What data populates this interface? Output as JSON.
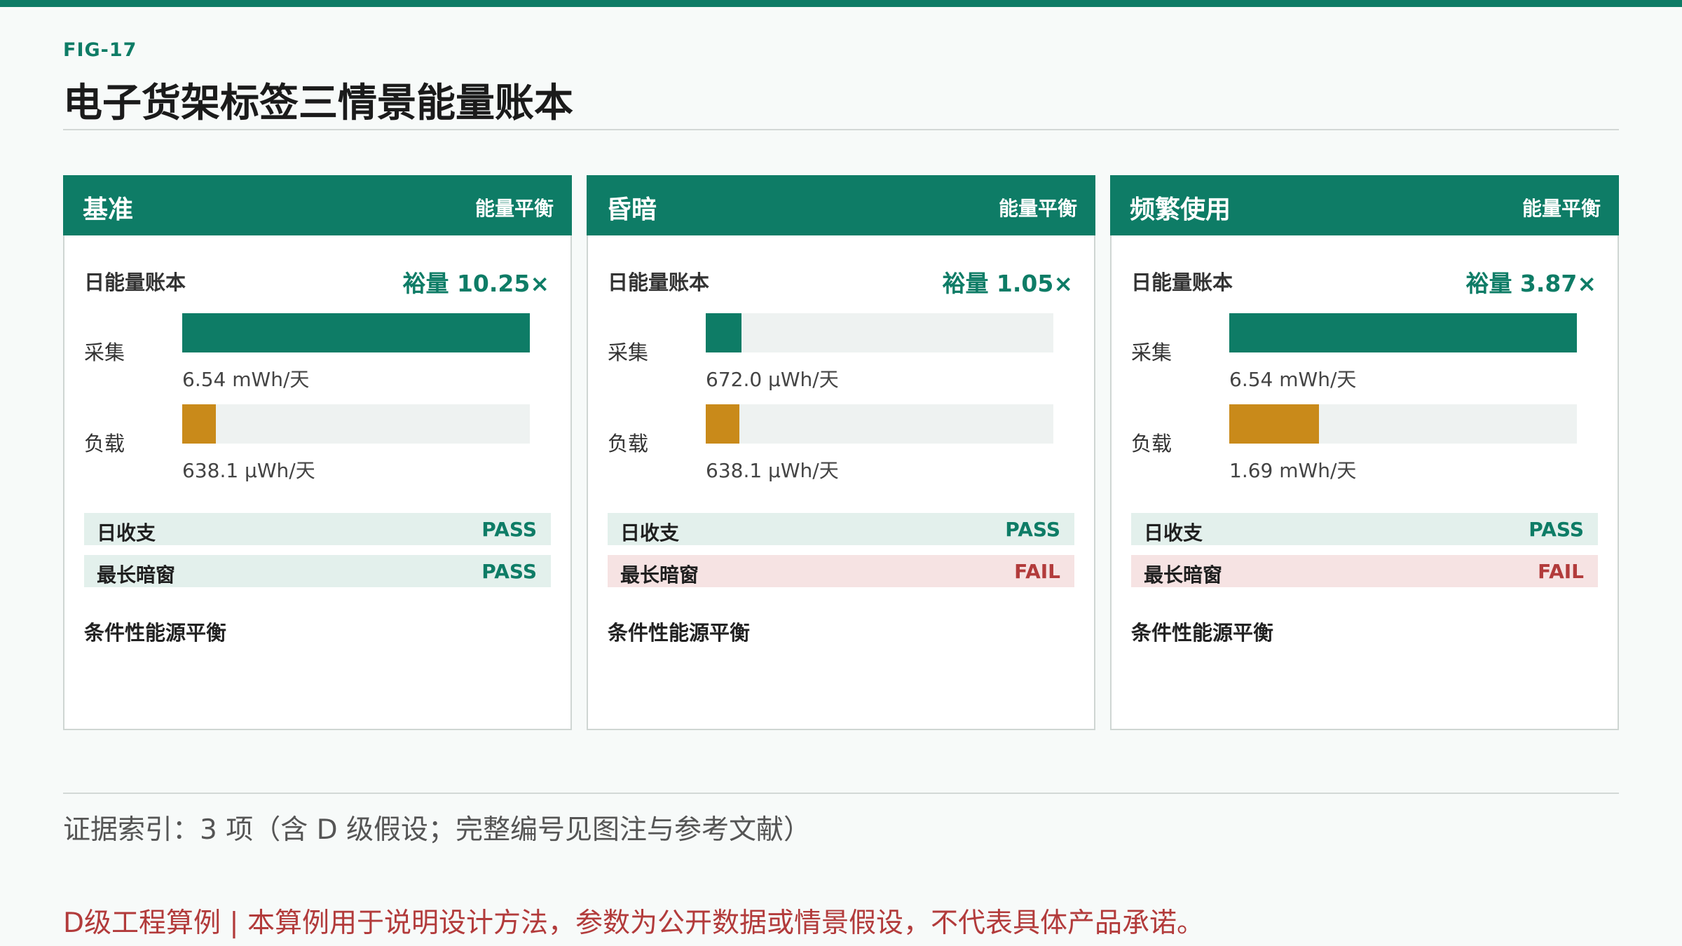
{
  "fig_id": "FIG-17",
  "title": "电子货架标签三情景能量账本",
  "scenarios": [
    {
      "name": "基准",
      "tag": "能量平衡",
      "ledger_label": "日能量账本",
      "margin": "裕量 10.25×",
      "harvest_label": "采集",
      "harvest_value": "6.54 mWh/天",
      "harvest_fraction": 1.0,
      "load_label": "负载",
      "load_value": "638.1 μWh/天",
      "load_fraction": 0.0976,
      "daily_balance_label": "日收支",
      "daily_balance_status": "PASS",
      "dark_window_label": "最长暗窗",
      "dark_window_status": "PASS",
      "condition": "条件性能源平衡"
    },
    {
      "name": "昏暗",
      "tag": "能量平衡",
      "ledger_label": "日能量账本",
      "margin": "裕量 1.05×",
      "harvest_label": "采集",
      "harvest_value": "672.0 μWh/天",
      "harvest_fraction": 0.1027,
      "load_label": "负载",
      "load_value": "638.1 μWh/天",
      "load_fraction": 0.0976,
      "daily_balance_label": "日收支",
      "daily_balance_status": "PASS",
      "dark_window_label": "最长暗窗",
      "dark_window_status": "FAIL",
      "condition": "条件性能源平衡"
    },
    {
      "name": "频繁使用",
      "tag": "能量平衡",
      "ledger_label": "日能量账本",
      "margin": "裕量 3.87×",
      "harvest_label": "采集",
      "harvest_value": "6.54 mWh/天",
      "harvest_fraction": 1.0,
      "load_label": "负载",
      "load_value": "1.69 mWh/天",
      "load_fraction": 0.2584,
      "daily_balance_label": "日收支",
      "daily_balance_status": "PASS",
      "dark_window_label": "最长暗窗",
      "dark_window_status": "FAIL",
      "condition": "条件性能源平衡"
    }
  ],
  "evidence": "证据索引：3 项（含 D 级假设；完整编号见图注与参考文献）",
  "disclaimer": "D级工程算例 | 本算例用于说明设计方法，参数为公开数据或情景假设，不代表具体产品承诺。",
  "colors": {
    "accent": "#0e7c66",
    "load": "#c98a1a",
    "pass_bg": "#e3f0ec",
    "fail_bg": "#f6e3e3",
    "fail_text": "#b23b3b"
  }
}
